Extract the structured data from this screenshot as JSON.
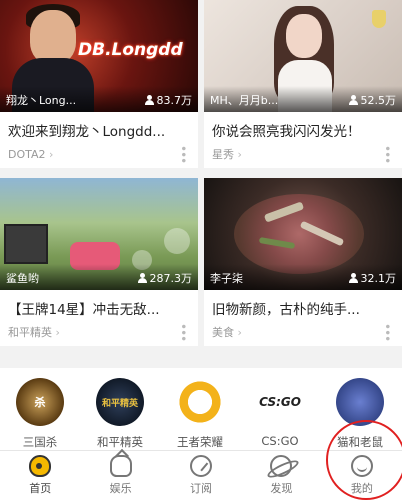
{
  "cards": [
    {
      "streamer": "翔龙丶Long...",
      "viewers": "83.7万",
      "title": "欢迎来到翔龙丶Longdd...",
      "category": "DOTA2",
      "logo": "DB.Longdd"
    },
    {
      "streamer": "MH、月月b...",
      "viewers": "52.5万",
      "title": "你说会照亮我闪闪发光！",
      "category": "星秀"
    },
    {
      "streamer": "鲨鱼哟",
      "viewers": "287.3万",
      "title": "【王牌14星】冲击无敌...",
      "category": "和平精英"
    },
    {
      "streamer": "李子柒",
      "viewers": "32.1万",
      "title": "旧物新颜，古朴的纯手...",
      "category": "美食"
    }
  ],
  "games": [
    {
      "name": "三国杀",
      "icon": "sanguosha-icon",
      "icon_text": "杀"
    },
    {
      "name": "和平精英",
      "icon": "peace-elite-icon",
      "icon_text": "和平精英"
    },
    {
      "name": "王者荣耀",
      "icon": "honor-of-kings-icon",
      "icon_text": ""
    },
    {
      "name": "CS:GO",
      "icon": "csgo-icon",
      "icon_text": "CS:GO"
    },
    {
      "name": "猫和老鼠",
      "icon": "tom-and-jerry-icon",
      "icon_text": ""
    }
  ],
  "nav": [
    {
      "label": "首页",
      "icon": "home-icon",
      "active": true
    },
    {
      "label": "娱乐",
      "icon": "entertainment-icon",
      "active": false
    },
    {
      "label": "订阅",
      "icon": "subscribe-icon",
      "active": false
    },
    {
      "label": "发现",
      "icon": "discover-icon",
      "active": false
    },
    {
      "label": "我的",
      "icon": "profile-icon",
      "active": false
    }
  ],
  "colors": {
    "accent": "#f5b800",
    "highlight_circle": "#e02020"
  }
}
